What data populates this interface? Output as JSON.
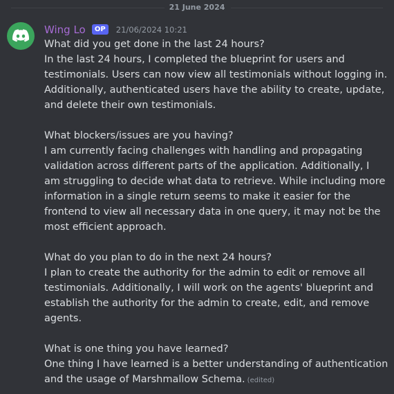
{
  "divider": {
    "date": "21 June 2024"
  },
  "message": {
    "author": "Wing Lo",
    "badge": "OP",
    "timestamp": "21/06/2024 10:21",
    "avatar_color": "#3ba55c",
    "edited_label": "(edited)",
    "paragraphs": [
      [
        "What did you get done in the last 24 hours?",
        "In the last 24 hours, I completed the blueprint for users and",
        "testimonials. Users can now view all testimonials without logging in.",
        "Additionally, authenticated users have the ability to create, update,",
        "and delete their own testimonials."
      ],
      [
        "What blockers/issues are you having?",
        "I am currently facing challenges with handling and propagating",
        "validation across different parts of the application. Additionally, I",
        "am struggling to decide what data to retrieve. While including more",
        "information in a single return seems to make it easier for the",
        "frontend to view all necessary data in one query, it may not be the",
        "most efficient approach."
      ],
      [
        "What do you plan to do in the next 24 hours?",
        "I plan to create the authority for the admin to edit or remove all",
        "testimonials. Additionally, I will work on the agents' blueprint and",
        "establish the authority for the admin to create, edit, and remove",
        "agents."
      ],
      [
        "What is one thing you have learned?",
        "One thing I have learned is a better understanding of authentication",
        "and the usage of Marshmallow Schema."
      ]
    ]
  }
}
